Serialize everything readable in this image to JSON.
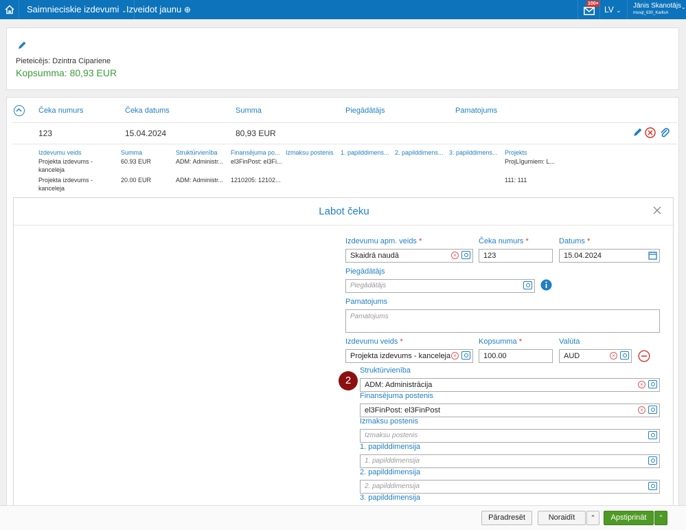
{
  "topbar": {
    "menu1_label": "Saimnieciskie izdevumi",
    "menu2_label": "Izveidot jaunu",
    "badge": "100+",
    "lang": "LV",
    "user_name": "Jānis Skanotājs",
    "user_sub": "mssql_630_KarlisA"
  },
  "summary": {
    "requester": "Pieteicējs: Dzintra Cipariene",
    "total": "Kopsumma: 80,93 EUR"
  },
  "receipts": {
    "headers": [
      "Čeka numurs",
      "Čeka datums",
      "Summa",
      "Piegādātājs",
      "Pamatojums"
    ],
    "row": {
      "number": "123",
      "date": "15.04.2024",
      "amount": "80,93 EUR"
    },
    "sub_headers": [
      "Izdevumu veids",
      "Summa",
      "Struktūrvienība",
      "Finansējuma po...",
      "Izmaksu postenis",
      "1. papilddimens...",
      "2. papilddimens...",
      "3. papilddimens...",
      "Projekts"
    ],
    "sub_rows": [
      {
        "type": "Projekta izdevums - kanceleja",
        "amount": "60.93 EUR",
        "unit": "ADM: Administr...",
        "fin": "el3FinPost: el3Fi...",
        "project": "ProjLīgumiem: L..."
      },
      {
        "type": "Projekta izdevums - kanceleja",
        "amount": "20.00 EUR",
        "unit": "ADM: Administr...",
        "fin": "1210205: 12102...",
        "project": "111: 111"
      }
    ]
  },
  "modal": {
    "title": "Labot čeku",
    "expense_pay_type_label": "Izdevumu apm. veids",
    "expense_pay_type_value": "Skaidrā naudā",
    "receipt_no_label": "Čeka numurs",
    "receipt_no_value": "123",
    "date_label": "Datums",
    "date_value": "15.04.2024",
    "supplier_label": "Piegādātājs",
    "supplier_placeholder": "Piegādātājs",
    "basis_label": "Pamatojums",
    "basis_placeholder": "Pamatojums",
    "expense_type_label": "Izdevumu veids",
    "expense_type_value": "Projekta izdevums - kanceleja",
    "total_label": "Kopsumma",
    "total_value": "100.00",
    "currency_label": "Valūta",
    "currency_value": "AUD",
    "step_number": "2",
    "unit_label": "Struktūrvienība",
    "unit_value": "ADM: Administrācija",
    "fin_label": "Finansējuma postenis",
    "fin_value": "el3FinPost: el3FinPost",
    "cost_label": "Izmaksu postenis",
    "cost_placeholder": "Izmaksu postenis",
    "dim1_label": "1. papilddimensija",
    "dim1_placeholder": "1. papilddimensija",
    "dim2_label": "2. papilddimensija",
    "dim2_placeholder": "2. papilddimensija",
    "dim3_label": "3. papilddimensija",
    "required_mark": "*"
  },
  "footer": {
    "forward": "Pāradresēt",
    "reject": "Noraidīt",
    "approve": "Apstiprināt"
  },
  "colors": {
    "brand": "#0d73bb",
    "accent": "#1f7fc4",
    "success": "#4f9a26",
    "danger": "#d9342b"
  }
}
